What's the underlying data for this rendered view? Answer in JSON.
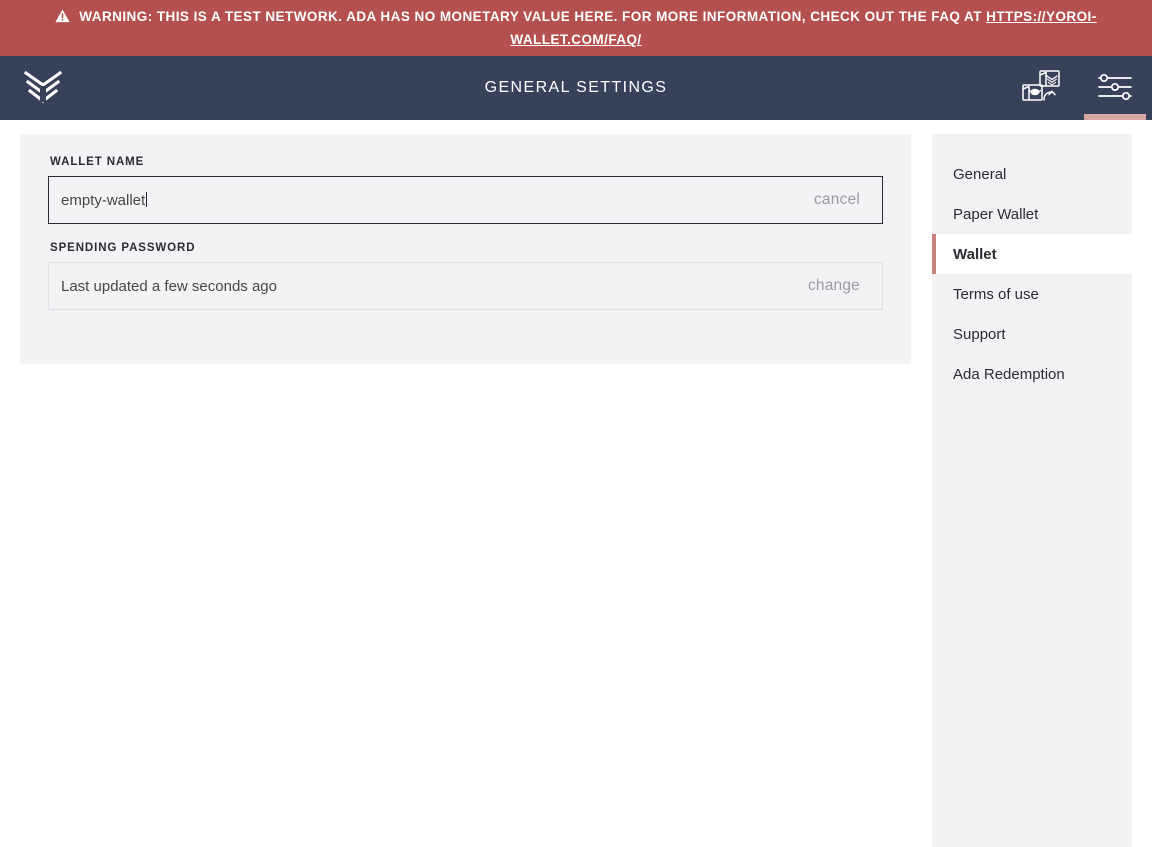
{
  "warning": {
    "icon": "warning-triangle-icon",
    "text": "WARNING: THIS IS A TEST NETWORK. ADA HAS NO MONETARY VALUE HERE. FOR MORE INFORMATION, CHECK OUT THE FAQ AT ",
    "link_text": "HTTPS://YOROI-WALLET.COM/FAQ/",
    "background_color": "#b4504f",
    "text_color": "#ffffff"
  },
  "navbar": {
    "logo_icon": "yoroi-logo-icon",
    "title": "GENERAL SETTINGS",
    "background_color": "#38415a",
    "actions": [
      {
        "icon": "switch-wallet-icon",
        "active": false
      },
      {
        "icon": "settings-sliders-icon",
        "active": true
      }
    ],
    "active_indicator_color": "#d9a7a2"
  },
  "settings": {
    "wallet_name": {
      "label": "WALLET NAME",
      "value": "empty-wallet",
      "placeholder": "Wallet name",
      "action_label": "cancel",
      "focused": true
    },
    "spending_password": {
      "label": "SPENDING PASSWORD",
      "value": "Last updated a few seconds ago",
      "action_label": "change",
      "focused": false
    }
  },
  "settings_menu": {
    "active_border_color": "#c8837a",
    "items": [
      {
        "label": "General",
        "active": false
      },
      {
        "label": "Paper Wallet",
        "active": false
      },
      {
        "label": "Wallet",
        "active": true
      },
      {
        "label": "Terms of use",
        "active": false
      },
      {
        "label": "Support",
        "active": false
      },
      {
        "label": "Ada Redemption",
        "active": false
      }
    ]
  }
}
